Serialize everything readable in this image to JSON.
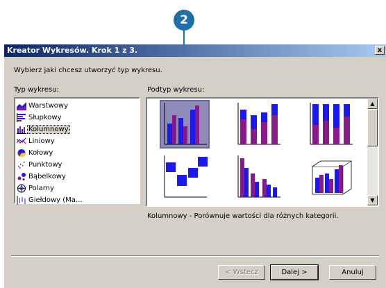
{
  "callout": {
    "number": "2"
  },
  "window": {
    "title": "Kreator Wykresów. Krok 1 z 3.",
    "close_glyph": "x"
  },
  "instruction": "Wybierz jaki chcesz utworzyć typ wykresu.",
  "type_list": {
    "label": "Typ wykresu:",
    "selected": "Kolumnowy",
    "items": [
      {
        "label": "Warstwowy",
        "icon": "area-chart-icon"
      },
      {
        "label": "Słupkowy",
        "icon": "bar-chart-icon"
      },
      {
        "label": "Kolumnowy",
        "icon": "column-chart-icon"
      },
      {
        "label": "Liniowy",
        "icon": "line-chart-icon"
      },
      {
        "label": "Kołowy",
        "icon": "pie-chart-icon"
      },
      {
        "label": "Punktowy",
        "icon": "scatter-chart-icon"
      },
      {
        "label": "Bąbelkowy",
        "icon": "bubble-chart-icon"
      },
      {
        "label": "Polarny",
        "icon": "polar-chart-icon"
      },
      {
        "label": "Giełdowy (Ma...",
        "icon": "stock-chart-icon"
      }
    ]
  },
  "subtype": {
    "label": "Podtyp wykresu:",
    "selected_index": 0,
    "thumbnails": [
      "clustered-column",
      "stacked-column",
      "100-stacked-column",
      "floating-column",
      "clustered-column-descending",
      "3d-column"
    ],
    "description": "Kolumnowy - Porównuje wartości dla różnych kategorii."
  },
  "buttons": {
    "back": "< Wstecz",
    "next": "Dalej >",
    "cancel": "Anuluj"
  },
  "colors": {
    "title_start": "#0a246a",
    "title_end": "#a6caf0",
    "bar_blue": "#1a1aee",
    "bar_purple": "#8a1a8a",
    "face": "#d4d0c8",
    "callout": "#1f6fa8"
  }
}
